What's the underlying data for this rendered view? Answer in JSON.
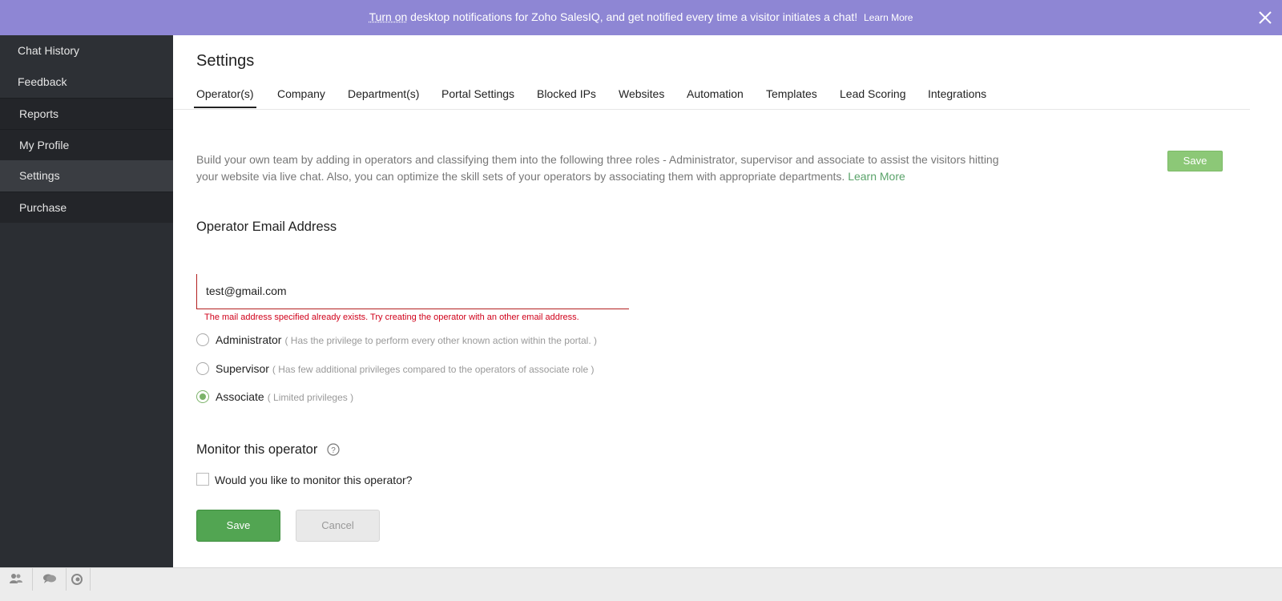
{
  "banner": {
    "link_text": "Turn on",
    "message": " desktop notifications for Zoho SalesIQ, and get notified every time a visitor initiates a chat!",
    "learn_more": "Learn More",
    "close_icon": "close-icon"
  },
  "sidebar": {
    "items": [
      {
        "label": "Chat History"
      },
      {
        "label": "Feedback"
      },
      {
        "label": "Reports"
      },
      {
        "label": "My Profile"
      },
      {
        "label": "Settings",
        "active": true
      },
      {
        "label": "Purchase"
      }
    ]
  },
  "main": {
    "title": "Settings",
    "tabs": [
      {
        "label": "Operator(s)",
        "active": true
      },
      {
        "label": "Company"
      },
      {
        "label": "Department(s)"
      },
      {
        "label": "Portal Settings"
      },
      {
        "label": "Blocked IPs"
      },
      {
        "label": "Websites"
      },
      {
        "label": "Automation"
      },
      {
        "label": "Templates"
      },
      {
        "label": "Lead Scoring"
      },
      {
        "label": "Integrations"
      }
    ],
    "description": "Build your own team by adding in operators and classifying them into the following three roles - Administrator, supervisor and associate to assist the visitors hitting your website via live chat. Also, you can optimize the skill sets of your operators by associating them with appropriate departments.",
    "description_link": "Learn More",
    "top_save_label": "Save"
  },
  "form": {
    "email_section_title": "Operator Email Address",
    "email_value": "test@gmail.com",
    "error_message": "The mail address specified already exists. Try creating the operator with an other email address.",
    "roles": [
      {
        "label": "Administrator",
        "hint": "( Has the privilege to perform every other known action within the portal. )",
        "checked": false
      },
      {
        "label": "Supervisor",
        "hint": "( Has few additional privileges compared to the operators of associate role )",
        "checked": false
      },
      {
        "label": "Associate",
        "hint": "( Limited privileges )",
        "checked": true
      }
    ],
    "monitor_title": "Monitor this operator",
    "monitor_checkbox_label": "Would you like to monitor this operator?",
    "monitor_checked": false,
    "save_label": "Save",
    "cancel_label": "Cancel"
  },
  "bottombar": {
    "icons": [
      "operators-icon",
      "chats-icon",
      "visitors-icon"
    ]
  },
  "colors": {
    "banner": "#8e86d4",
    "sidebar": "#2b2e33",
    "accent_green": "#52a552",
    "link_green": "#5aa36a",
    "error_red": "#d0021b"
  }
}
